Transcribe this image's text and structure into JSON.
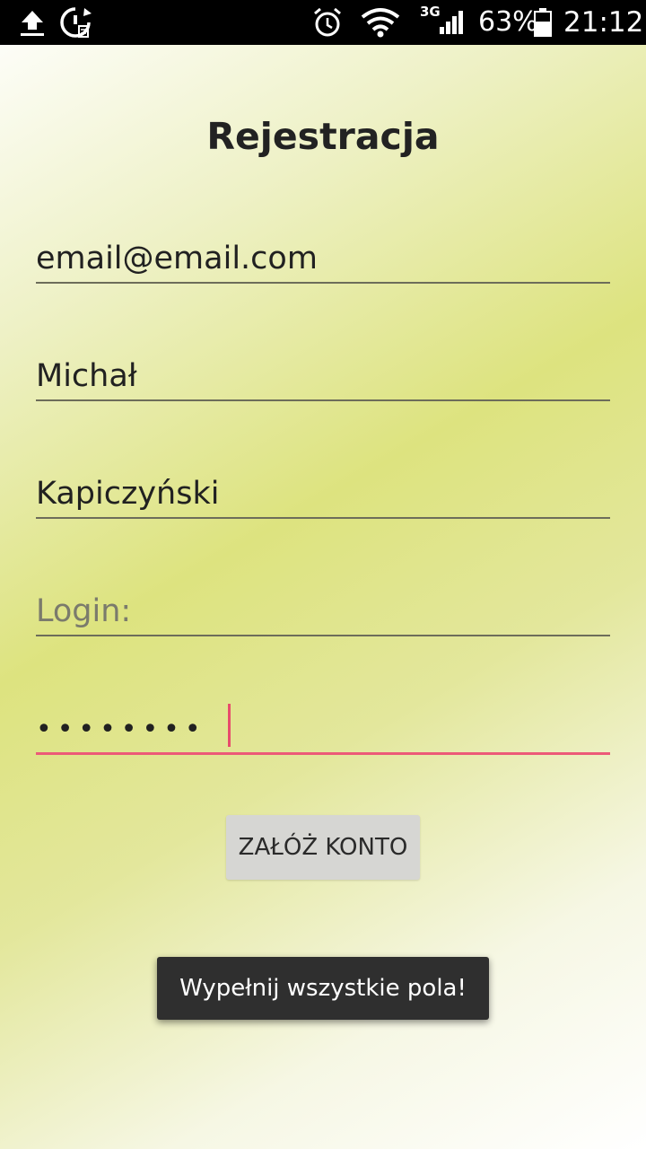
{
  "status_bar": {
    "network": "3G",
    "battery": "63%",
    "time": "21:12",
    "icons": [
      "upload-icon",
      "data-saver-icon",
      "alarm-icon",
      "wifi-icon",
      "signal-icon",
      "battery-icon"
    ]
  },
  "form": {
    "title": "Rejestracja",
    "email": {
      "value": "email@email.com"
    },
    "first_name": {
      "value": "Michał"
    },
    "last_name": {
      "value": "Kapiczyński"
    },
    "login": {
      "value": "",
      "placeholder": "Login:"
    },
    "password": {
      "masked": "••••••••"
    }
  },
  "button": {
    "label": "ZAŁÓŻ KONTO"
  },
  "toast": {
    "message": "Wypełnij wszystkie pola!"
  },
  "colors": {
    "accent": "#ec5a78",
    "status_bar": "#000000",
    "toast_bg": "#2f2f2f",
    "button_bg": "#d6d6d3"
  }
}
